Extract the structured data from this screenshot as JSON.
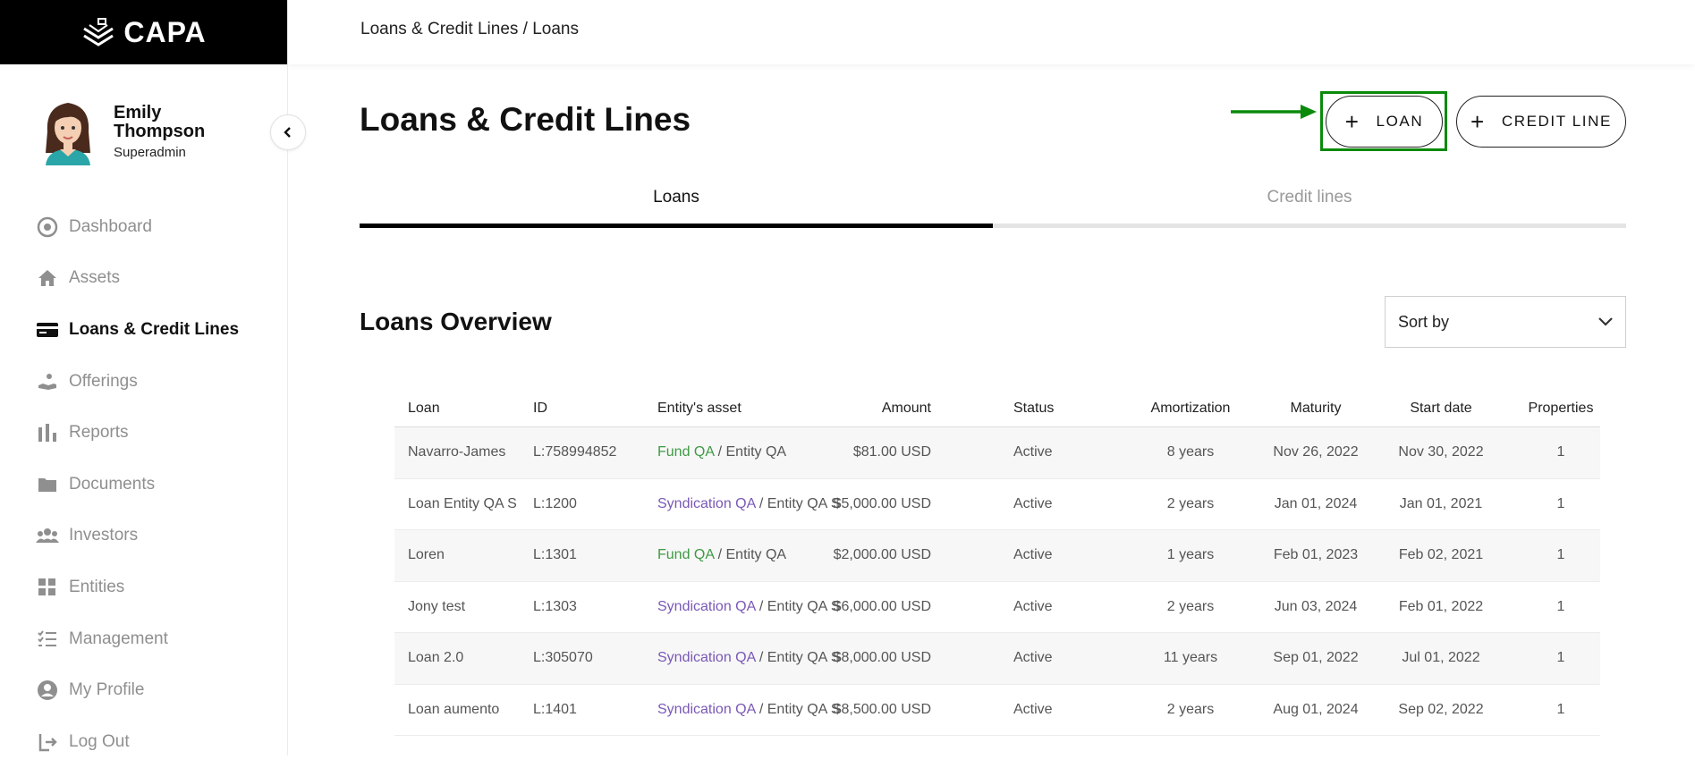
{
  "app": {
    "logo_text": "CAPA"
  },
  "user": {
    "name": "Emily Thompson",
    "role": "Superadmin"
  },
  "sidebar": {
    "items": [
      {
        "label": "Dashboard",
        "icon": "dashboard-icon",
        "active": false
      },
      {
        "label": "Assets",
        "icon": "home-icon",
        "active": false
      },
      {
        "label": "Loans & Credit Lines",
        "icon": "credit-card-icon",
        "active": true
      },
      {
        "label": "Offerings",
        "icon": "hand-coin-icon",
        "active": false
      },
      {
        "label": "Reports",
        "icon": "bar-chart-icon",
        "active": false
      },
      {
        "label": "Documents",
        "icon": "folder-icon",
        "active": false
      },
      {
        "label": "Investors",
        "icon": "people-icon",
        "active": false
      },
      {
        "label": "Entities",
        "icon": "grid-icon",
        "active": false
      },
      {
        "label": "Management",
        "icon": "checklist-icon",
        "active": false
      },
      {
        "label": "My Profile",
        "icon": "user-circle-icon",
        "active": false
      },
      {
        "label": "Log Out",
        "icon": "logout-icon",
        "active": false
      }
    ]
  },
  "header": {
    "breadcrumb": "Loans & Credit Lines / Loans"
  },
  "page": {
    "title": "Loans & Credit Lines",
    "loan_button": "LOAN",
    "credit_line_button": "CREDIT LINE"
  },
  "tabs": [
    {
      "label": "Loans",
      "active": true
    },
    {
      "label": "Credit lines",
      "active": false
    }
  ],
  "overview": {
    "title": "Loans Overview",
    "sort_label": "Sort by"
  },
  "table": {
    "columns": [
      "Loan",
      "ID",
      "Entity's asset",
      "Amount",
      "Status",
      "Amortization",
      "Maturity",
      "Start date",
      "Properties"
    ],
    "rows": [
      {
        "loan": "Navarro-James",
        "id": "L:758994852",
        "asset_link": "Fund QA",
        "asset_type": "fund",
        "asset_rest": " / Entity QA",
        "amount": "$81.00 USD",
        "status": "Active",
        "amortization": "8 years",
        "maturity": "Nov 26, 2022",
        "start": "Nov 30, 2022",
        "properties": "1"
      },
      {
        "loan": "Loan Entity QA S",
        "id": "L:1200",
        "asset_link": "Syndication QA",
        "asset_type": "synd",
        "asset_rest": " / Entity QA S",
        "amount": "$5,000.00 USD",
        "status": "Active",
        "amortization": "2 years",
        "maturity": "Jan 01, 2024",
        "start": "Jan 01, 2021",
        "properties": "1"
      },
      {
        "loan": "Loren",
        "id": "L:1301",
        "asset_link": "Fund QA",
        "asset_type": "fund",
        "asset_rest": " / Entity QA",
        "amount": "$2,000.00 USD",
        "status": "Active",
        "amortization": "1 years",
        "maturity": "Feb 01, 2023",
        "start": "Feb 02, 2021",
        "properties": "1"
      },
      {
        "loan": "Jony test",
        "id": "L:1303",
        "asset_link": "Syndication QA",
        "asset_type": "synd",
        "asset_rest": " / Entity QA S",
        "amount": "$6,000.00 USD",
        "status": "Active",
        "amortization": "2 years",
        "maturity": "Jun 03, 2024",
        "start": "Feb 01, 2022",
        "properties": "1"
      },
      {
        "loan": "Loan 2.0",
        "id": "L:305070",
        "asset_link": "Syndication QA",
        "asset_type": "synd",
        "asset_rest": " / Entity QA S",
        "amount": "$8,000.00 USD",
        "status": "Active",
        "amortization": "11 years",
        "maturity": "Sep 01, 2022",
        "start": "Jul 01, 2022",
        "properties": "1"
      },
      {
        "loan": "Loan aumento",
        "id": "L:1401",
        "asset_link": "Syndication QA",
        "asset_type": "synd",
        "asset_rest": " / Entity QA S",
        "amount": "$8,500.00 USD",
        "status": "Active",
        "amortization": "2 years",
        "maturity": "Aug 01, 2024",
        "start": "Sep 02, 2022",
        "properties": "1"
      }
    ]
  },
  "colors": {
    "fund_link": "#3f9a45",
    "syndication_link": "#7a58b6",
    "highlight": "#0a8a0a",
    "sidebar_top": "#000000"
  }
}
